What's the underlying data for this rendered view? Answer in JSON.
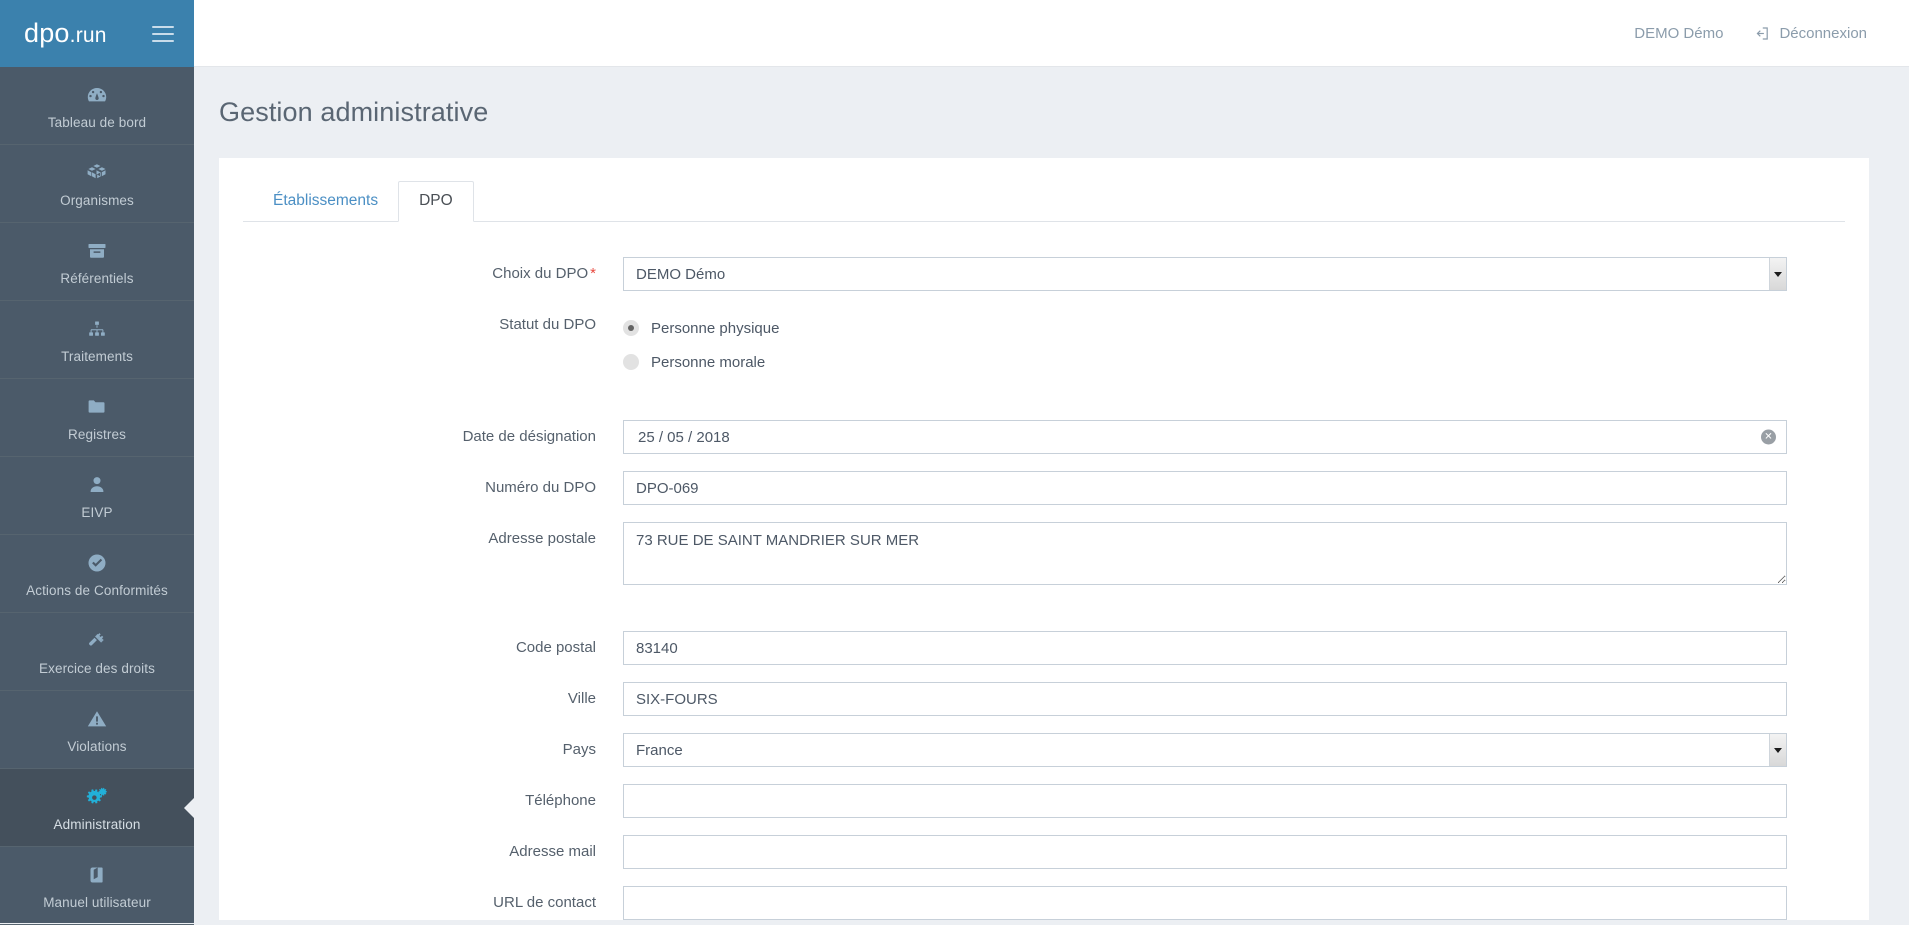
{
  "brand": {
    "logo_main": "dpo",
    "logo_suffix": ".run",
    "menu_icon": "hamburger-icon"
  },
  "topbar": {
    "user": "DEMO Démo",
    "logout": "Déconnexion",
    "logout_icon": "sign-out-icon"
  },
  "sidebar": {
    "items": [
      {
        "label": "Tableau de bord",
        "icon": "dashboard-gauge-icon",
        "active": false
      },
      {
        "label": "Organismes",
        "icon": "boxes-icon",
        "active": false
      },
      {
        "label": "Référentiels",
        "icon": "archive-box-icon",
        "active": false
      },
      {
        "label": "Traitements",
        "icon": "sitemap-icon",
        "active": false
      },
      {
        "label": "Registres",
        "icon": "folder-icon",
        "active": false
      },
      {
        "label": "EIVP",
        "icon": "user-icon",
        "active": false
      },
      {
        "label": "Actions de Conformités",
        "icon": "check-circle-icon",
        "active": false
      },
      {
        "label": "Exercice des droits",
        "icon": "gavel-icon",
        "active": false
      },
      {
        "label": "Violations",
        "icon": "warning-triangle-icon",
        "active": false
      },
      {
        "label": "Administration",
        "icon": "gears-icon",
        "active": true
      },
      {
        "label": "Manuel utilisateur",
        "icon": "book-icon",
        "active": false
      }
    ]
  },
  "page": {
    "title": "Gestion administrative"
  },
  "tabs": [
    {
      "label": "Établissements",
      "active": false
    },
    {
      "label": "DPO",
      "active": true
    }
  ],
  "form": {
    "choix_dpo": {
      "label": "Choix du DPO",
      "required_mark": "*",
      "value": "DEMO Démo",
      "options": [
        "DEMO Démo"
      ]
    },
    "statut_dpo": {
      "label": "Statut du DPO",
      "options": [
        {
          "label": "Personne physique",
          "selected": true
        },
        {
          "label": "Personne morale",
          "selected": false
        }
      ]
    },
    "date_designation": {
      "label": "Date de désignation",
      "value": "25 / 05 / 2018",
      "placeholder": "jj / mm / aaaa",
      "clear_icon": "clear-circle-icon"
    },
    "numero_dpo": {
      "label": "Numéro du DPO",
      "value": "DPO-069",
      "placeholder": ""
    },
    "adresse_postale": {
      "label": "Adresse postale",
      "value": "73 RUE DE SAINT MANDRIER SUR MER",
      "placeholder": ""
    },
    "code_postal": {
      "label": "Code postal",
      "value": "83140",
      "placeholder": ""
    },
    "ville": {
      "label": "Ville",
      "value": "SIX-FOURS",
      "placeholder": ""
    },
    "pays": {
      "label": "Pays",
      "value": "France",
      "options": [
        "France"
      ]
    },
    "telephone": {
      "label": "Téléphone",
      "value": "",
      "placeholder": ""
    },
    "adresse_mail": {
      "label": "Adresse mail",
      "value": "",
      "placeholder": ""
    },
    "url_contact": {
      "label": "URL de contact",
      "value": "",
      "placeholder": ""
    }
  },
  "colors": {
    "brand_blue": "#3b81ad",
    "sidebar": "#4b5a69",
    "sidebar_active": "#44505c",
    "accent_cyan": "#22b0d8",
    "page_bg": "#eceff3",
    "link_blue": "#4b8fc4",
    "required_red": "#e8493f"
  }
}
